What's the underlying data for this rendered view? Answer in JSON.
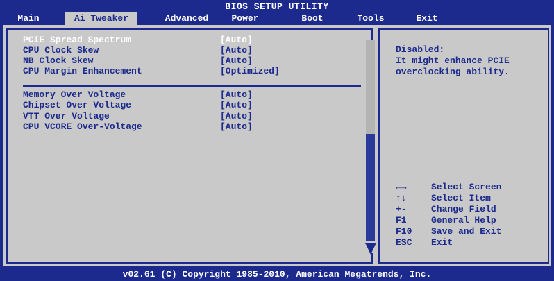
{
  "header": {
    "title": "BIOS SETUP UTILITY"
  },
  "tabs": [
    "Main",
    "Ai Tweaker",
    "Advanced",
    "Power",
    "Boot",
    "Tools",
    "Exit"
  ],
  "active_tab": "Ai Tweaker",
  "settings_group1": [
    {
      "label": "PCIE Spread Spectrum",
      "value": "[Auto]",
      "selected": true
    },
    {
      "label": "CPU Clock Skew",
      "value": "[Auto]"
    },
    {
      "label": "NB Clock Skew",
      "value": "[Auto]"
    },
    {
      "label": "CPU Margin Enhancement",
      "value": "[Optimized]"
    }
  ],
  "settings_group2": [
    {
      "label": "Memory Over Voltage",
      "value": "[Auto]"
    },
    {
      "label": "Chipset Over Voltage",
      "value": "[Auto]"
    },
    {
      "label": "VTT Over Voltage",
      "value": "[Auto]"
    },
    {
      "label": "CPU VCORE Over-Voltage",
      "value": "[Auto]"
    }
  ],
  "help_text": [
    "Disabled:",
    "It might enhance PCIE",
    "overclocking ability."
  ],
  "keys": [
    {
      "key": "←→",
      "desc": "Select Screen"
    },
    {
      "key": "↑↓",
      "desc": "Select Item"
    },
    {
      "key": "+-",
      "desc": "Change Field"
    },
    {
      "key": "F1",
      "desc": "General Help"
    },
    {
      "key": "F10",
      "desc": "Save and Exit"
    },
    {
      "key": "ESC",
      "desc": "Exit"
    }
  ],
  "footer": "v02.61 (C) Copyright 1985-2010, American Megatrends, Inc.",
  "colors": {
    "background": "#1b2a8c",
    "panel": "#c9c9c9",
    "text": "#1b2a8c",
    "highlight": "#ffffff"
  }
}
